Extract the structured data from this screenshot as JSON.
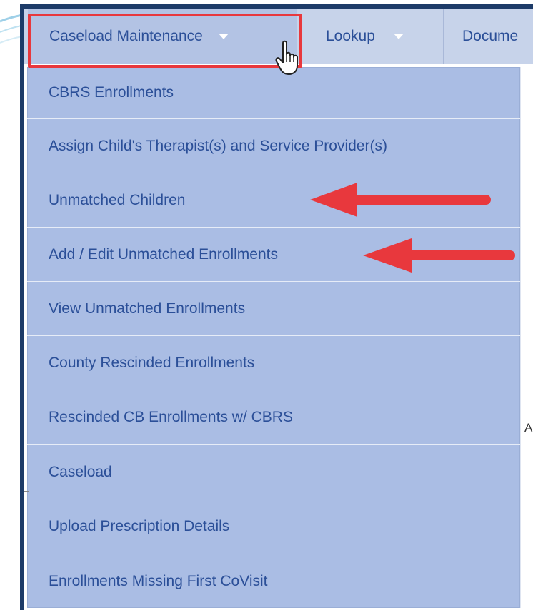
{
  "menubar": {
    "items": [
      {
        "label": "Caseload Maintenance",
        "has_dropdown": true,
        "active": true
      },
      {
        "label": "Lookup",
        "has_dropdown": true,
        "active": false
      },
      {
        "label": "Docume",
        "has_dropdown": false,
        "active": false
      }
    ]
  },
  "dropdown": {
    "items": [
      {
        "label": "CBRS Enrollments"
      },
      {
        "label": "Assign Child's Therapist(s) and Service Provider(s)"
      },
      {
        "label": "Unmatched Children"
      },
      {
        "label": "Add / Edit Unmatched Enrollments"
      },
      {
        "label": "View Unmatched Enrollments"
      },
      {
        "label": "County Rescinded Enrollments"
      },
      {
        "label": "Rescinded CB Enrollments w/ CBRS"
      },
      {
        "label": "Caseload"
      },
      {
        "label": "Upload Prescription Details"
      },
      {
        "label": "Enrollments Missing First CoVisit"
      }
    ]
  },
  "colors": {
    "menu_text": "#2b4f98",
    "menubar_bg": "#c7d3ea",
    "dropdown_bg": "#aabde4",
    "highlight_box": "#e8383d",
    "annotation_arrow": "#e8383d",
    "frame": "#1d3b68"
  },
  "annotations": {
    "highlighted_menu": "Caseload Maintenance",
    "arrows_point_to": [
      "Unmatched Children",
      "Add / Edit Unmatched Enrollments"
    ]
  },
  "icons": {
    "cursor": "hand-pointer-icon",
    "caret": "caret-down-icon"
  },
  "edge_text": "A"
}
